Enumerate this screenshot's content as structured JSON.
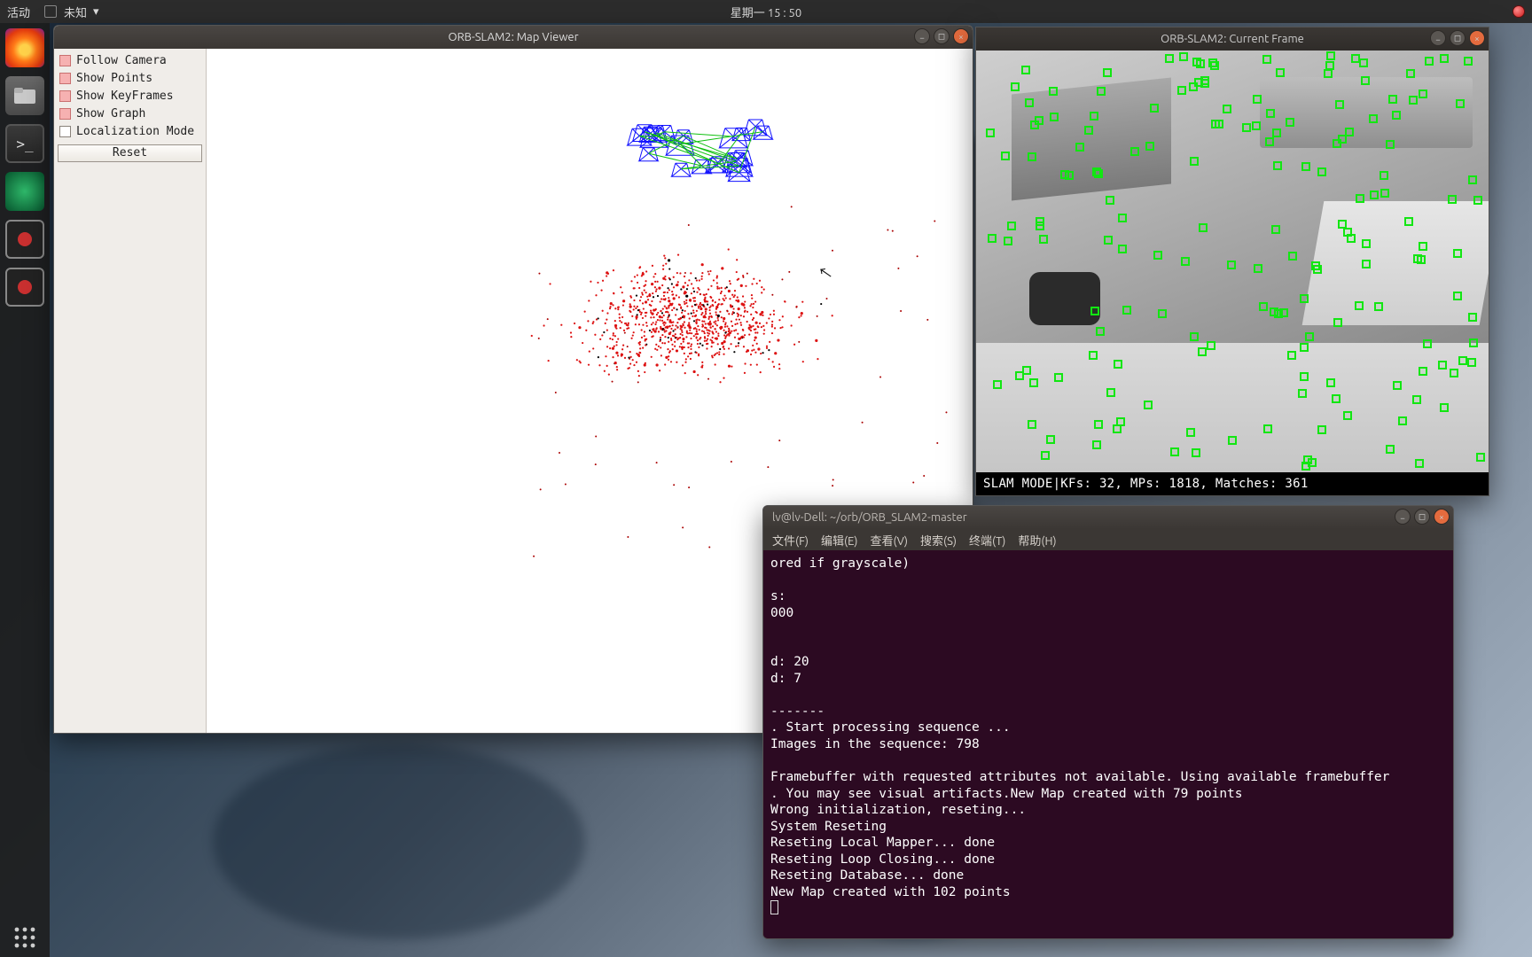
{
  "topbar": {
    "activities": "活动",
    "app_menu": "未知",
    "clock": "星期一 15 : 50"
  },
  "map_viewer": {
    "title": "ORB-SLAM2: Map Viewer",
    "controls": {
      "follow_camera": "Follow Camera",
      "show_points": "Show Points",
      "show_keyframes": "Show KeyFrames",
      "show_graph": "Show Graph",
      "localization_mode": "Localization Mode",
      "reset": "Reset"
    }
  },
  "frame_viewer": {
    "title": "ORB-SLAM2: Current Frame",
    "status_mode": "SLAM MODE",
    "status_sep": " | ",
    "status_detail": " KFs: 32, MPs: 1818, Matches: 361"
  },
  "terminal": {
    "title": "lv@lv-Dell: ~/orb/ORB_SLAM2-master",
    "menu": {
      "file": "文件(F)",
      "edit": "编辑(E)",
      "view": "查看(V)",
      "search": "搜索(S)",
      "terminal": "终端(T)",
      "help": "帮助(H)"
    },
    "lines": [
      "ored if grayscale)",
      "",
      "s:",
      "000",
      "",
      "",
      "d: 20",
      "d: 7",
      "",
      "-------",
      ". Start processing sequence ...",
      "Images in the sequence: 798",
      "",
      "Framebuffer with requested attributes not available. Using available framebuffer",
      ". You may see visual artifacts.New Map created with 79 points",
      "Wrong initialization, reseting...",
      "System Reseting",
      "Reseting Local Mapper... done",
      "Reseting Loop Closing... done",
      "Reseting Database... done",
      "New Map created with 102 points"
    ]
  }
}
